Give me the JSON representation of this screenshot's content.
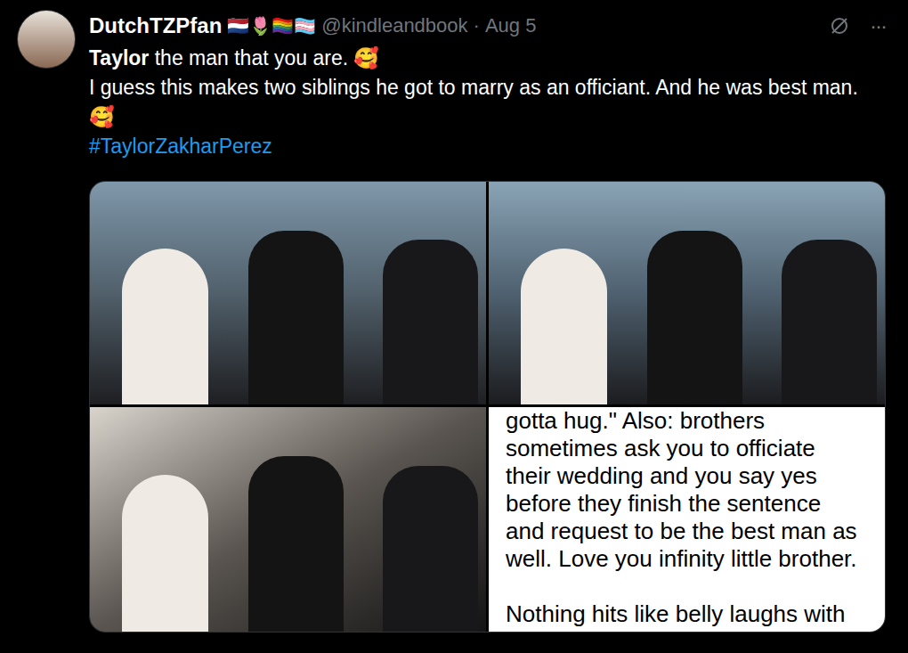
{
  "author": {
    "name": "DutchTZPfan",
    "flags": "🇳🇱🌷🏳️‍🌈🏳️‍⚧️",
    "handle": "@kindleandbook",
    "separator": "·",
    "date": "Aug 5"
  },
  "more": "···",
  "post": {
    "paragraphs": [
      [
        {
          "text": "Taylor",
          "bold": true
        },
        {
          "text": " the man that you are. 🥰",
          "bold": false
        }
      ],
      [
        {
          "text": "I guess this makes two siblings he got to marry as an officiant. And he was best man. 🥰",
          "bold": false
        }
      ]
    ],
    "hashtag": "#TaylorZakharPerez"
  },
  "media": [
    {
      "kind": "photo"
    },
    {
      "kind": "photo"
    },
    {
      "kind": "photo"
    },
    {
      "kind": "text",
      "lines": [
        "gotta hug.\" Also: brothers",
        "sometimes ask you to officiate",
        "their wedding and you say yes",
        "before they finish the sentence",
        "and request to be the best man as",
        "well. Love you infinity little brother.",
        "",
        "Nothing hits like belly laughs with"
      ]
    }
  ]
}
